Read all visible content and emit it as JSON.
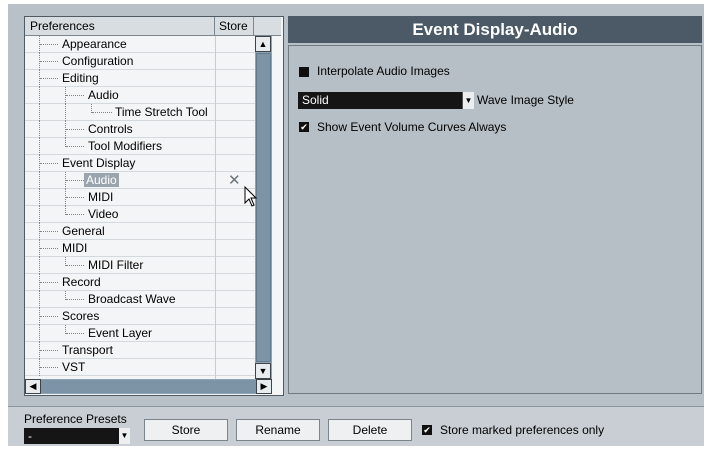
{
  "tree": {
    "header_preferences": "Preferences",
    "header_store": "Store",
    "items": [
      {
        "label": "Appearance"
      },
      {
        "label": "Configuration"
      },
      {
        "label": "Editing"
      },
      {
        "label": "Audio"
      },
      {
        "label": "Time Stretch Tool"
      },
      {
        "label": "Controls"
      },
      {
        "label": "Tool Modifiers"
      },
      {
        "label": "Event Display"
      },
      {
        "label": "Audio",
        "selected": true,
        "store_mark": "✕"
      },
      {
        "label": "MIDI"
      },
      {
        "label": "Video"
      },
      {
        "label": "General"
      },
      {
        "label": "MIDI"
      },
      {
        "label": "MIDI Filter"
      },
      {
        "label": "Record"
      },
      {
        "label": "Broadcast Wave"
      },
      {
        "label": "Scores"
      },
      {
        "label": "Event Layer"
      },
      {
        "label": "Transport"
      },
      {
        "label": "VST"
      }
    ]
  },
  "panel": {
    "title": "Event Display-Audio",
    "interpolate_label": "Interpolate Audio Images",
    "interpolate_checked": false,
    "wave_style_value": "Solid",
    "wave_style_label": "Wave Image Style",
    "show_curves_label": "Show Event Volume Curves Always",
    "show_curves_checked": true
  },
  "bottom": {
    "presets_label": "Preference Presets",
    "presets_value": "-",
    "store_label": "Store",
    "rename_label": "Rename",
    "delete_label": "Delete",
    "marked_only_label": "Store marked preferences only",
    "marked_only_checked": true
  },
  "icons": {
    "check": "✔",
    "arrow_down": "▼",
    "arrow_up": "▲",
    "arrow_left": "◀",
    "arrow_right": "▶"
  }
}
